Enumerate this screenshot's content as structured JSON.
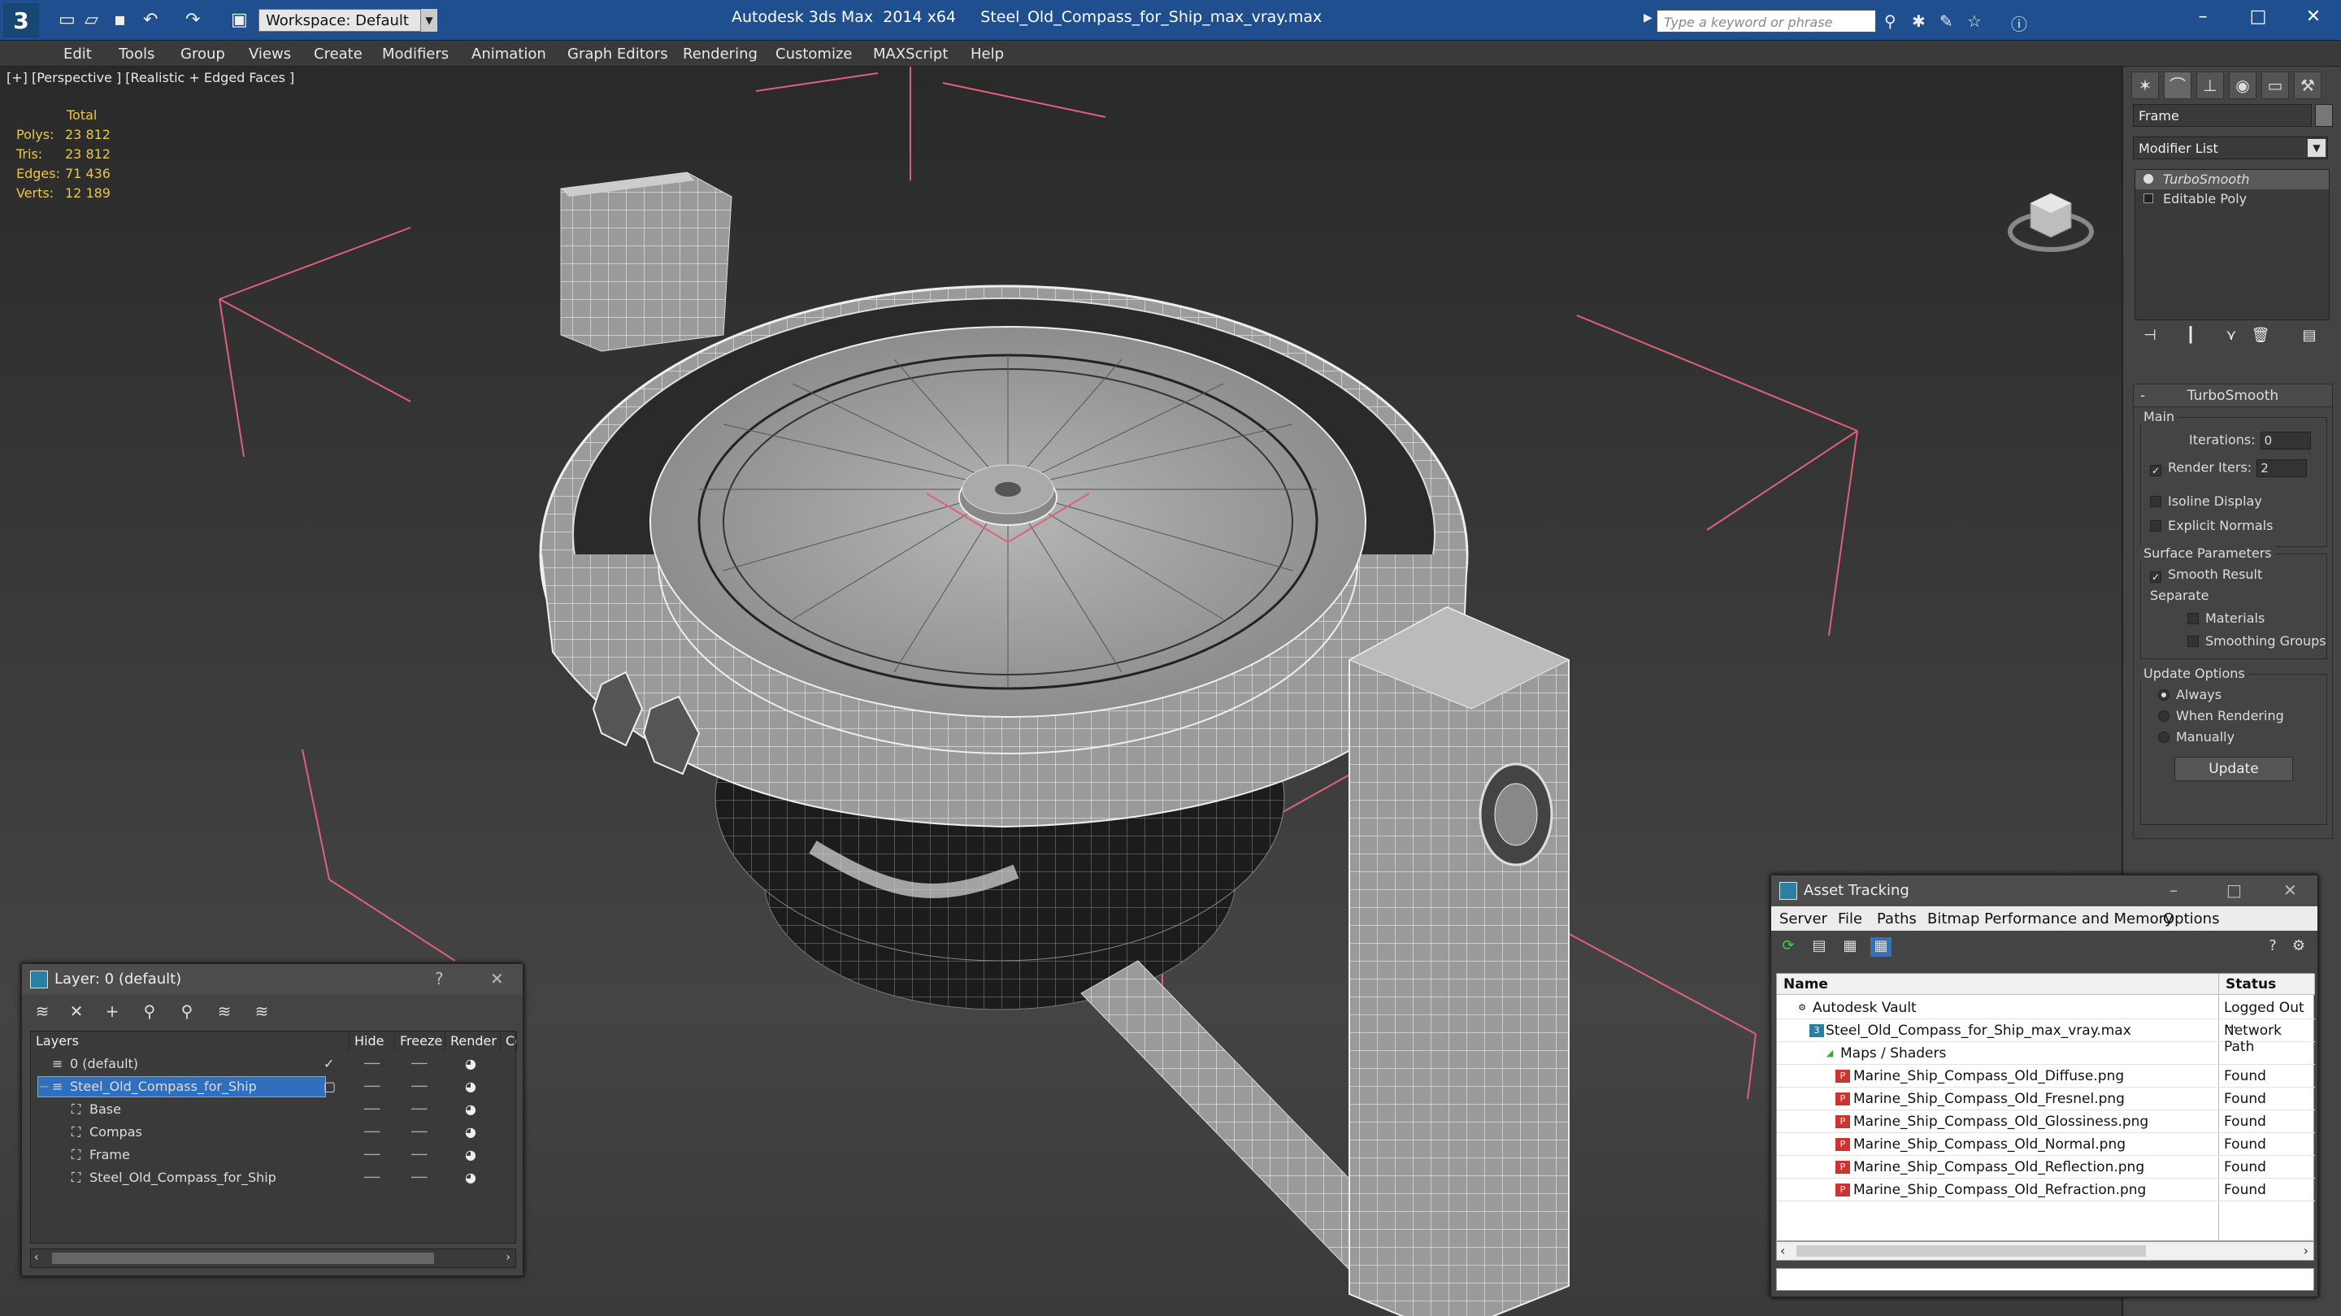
{
  "titlebar": {
    "workspace": "Workspace: Default",
    "app": "Autodesk 3ds Max  2014 x64",
    "file": "Steel_Old_Compass_for_Ship_max_vray.max",
    "search_placeholder": "Type a keyword or phrase"
  },
  "menu": [
    "Edit",
    "Tools",
    "Group",
    "Views",
    "Create",
    "Modifiers",
    "Animation",
    "Graph Editors",
    "Rendering",
    "Customize",
    "MAXScript",
    "Help"
  ],
  "viewport": {
    "label": "[+] [Perspective ] [Realistic + Edged Faces ]",
    "stats_header": "Total",
    "stats": [
      {
        "key": "Polys:",
        "val": "23 812"
      },
      {
        "key": "Tris:",
        "val": "23 812"
      },
      {
        "key": "Edges:",
        "val": "71 436"
      },
      {
        "key": "Verts:",
        "val": "12 189"
      }
    ]
  },
  "cmdpanel": {
    "object_name": "Frame",
    "modifier_list": "Modifier List",
    "stack": [
      "TurboSmooth",
      "Editable Poly"
    ],
    "turbosmooth": {
      "title": "TurboSmooth",
      "main": "Main",
      "iterations_label": "Iterations:",
      "iterations": "0",
      "render_iters_label": "Render Iters:",
      "render_iters": "2",
      "isoline": "Isoline Display",
      "explicit": "Explicit Normals",
      "surface": "Surface Parameters",
      "smooth": "Smooth Result",
      "separate": "Separate",
      "materials": "Materials",
      "smoothing_groups": "Smoothing Groups",
      "update_options": "Update Options",
      "always": "Always",
      "when_rendering": "When Rendering",
      "manually": "Manually",
      "update": "Update"
    }
  },
  "layer_window": {
    "title": "Layer: 0 (default)",
    "help": "?",
    "headers": {
      "layers": "Layers",
      "hide": "Hide",
      "freeze": "Freeze",
      "render": "Render",
      "c": "C("
    },
    "rows": [
      "0 (default)",
      "Steel_Old_Compass_for_Ship",
      "Base",
      "Compas",
      "Frame",
      "Steel_Old_Compass_for_Ship"
    ]
  },
  "asset_window": {
    "title": "Asset Tracking",
    "menu": [
      "Server",
      "File",
      "Paths",
      "Bitmap Performance and Memory",
      "Options"
    ],
    "headers": {
      "name": "Name",
      "status": "Status"
    },
    "rows": [
      {
        "name": "Autodesk Vault",
        "status": "Logged Out ..."
      },
      {
        "name": "Steel_Old_Compass_for_Ship_max_vray.max",
        "status": "Network Path"
      },
      {
        "name": "Maps / Shaders",
        "status": ""
      },
      {
        "name": "Marine_Ship_Compass_Old_Diffuse.png",
        "status": "Found"
      },
      {
        "name": "Marine_Ship_Compass_Old_Fresnel.png",
        "status": "Found"
      },
      {
        "name": "Marine_Ship_Compass_Old_Glossiness.png",
        "status": "Found"
      },
      {
        "name": "Marine_Ship_Compass_Old_Normal.png",
        "status": "Found"
      },
      {
        "name": "Marine_Ship_Compass_Old_Reflection.png",
        "status": "Found"
      },
      {
        "name": "Marine_Ship_Compass_Old_Refraction.png",
        "status": "Found"
      }
    ]
  },
  "colors": {
    "title_bg": "#1f4f8f",
    "viewport_bg": "#3a3a3a",
    "stats": "#e8c84a",
    "selection": "#2f6fbd",
    "gizmo": "#e0607a"
  }
}
